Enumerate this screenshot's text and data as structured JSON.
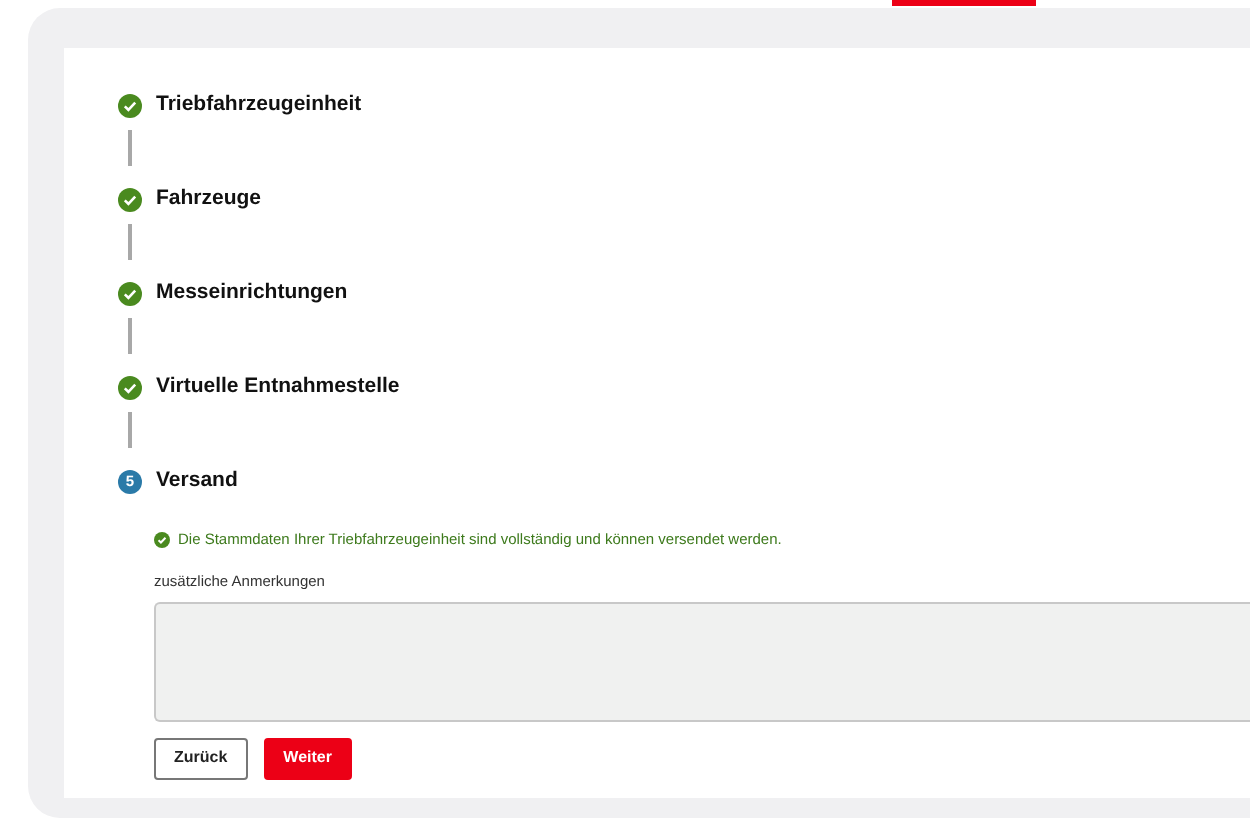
{
  "steps": [
    {
      "label": "Triebfahrzeugeinheit",
      "completed": true
    },
    {
      "label": "Fahrzeuge",
      "completed": true
    },
    {
      "label": "Messeinrichtungen",
      "completed": true
    },
    {
      "label": "Virtuelle Entnahmestelle",
      "completed": true
    },
    {
      "label": "Versand",
      "completed": false,
      "number": "5"
    }
  ],
  "success_message": "Die Stammdaten Ihrer Triebfahrzeugeinheit sind vollständig und können versendet werden.",
  "remarks": {
    "label": "zusätzliche Anmerkungen"
  },
  "buttons": [
    {
      "label": "Zurück",
      "kind": "secondary"
    },
    {
      "label": "Weiter",
      "kind": "primary"
    }
  ]
}
